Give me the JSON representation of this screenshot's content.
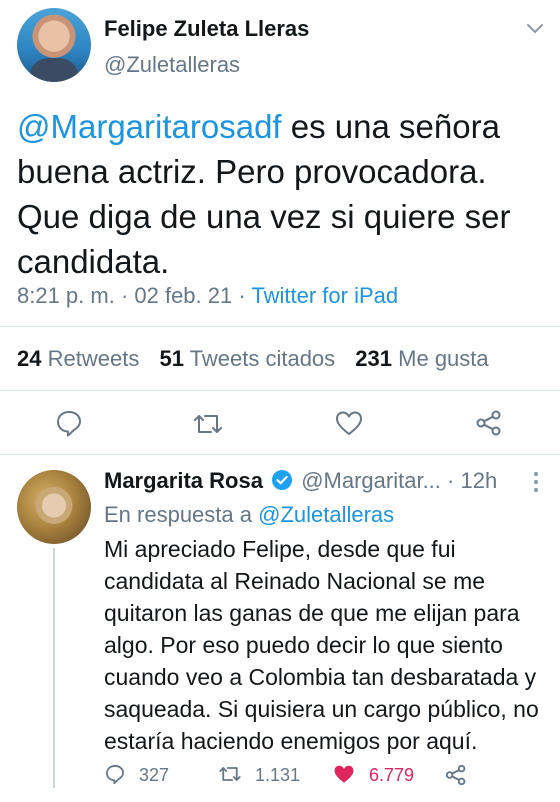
{
  "main_tweet": {
    "author_name": "Felipe Zuleta Lleras",
    "author_handle": "@Zuletalleras",
    "text_mention": "@Margaritarosadf",
    "text_rest": " es una señora buena actriz. Pero provocadora. Que diga de una vez si quiere ser candidata.",
    "time": "8:21 p. m. · 02 feb. 21 · ",
    "source": "Twitter for iPad",
    "retweets_count": "24",
    "retweets_label": "Retweets",
    "quotes_count": "51",
    "quotes_label": "Tweets citados",
    "likes_count": "231",
    "likes_label": "Me gusta"
  },
  "reply": {
    "author_name": "Margarita Rosa",
    "author_handle": "@Margaritar...",
    "time": "· 12h",
    "in_reply_prefix": "En respuesta a ",
    "in_reply_handle": "@Zuletalleras",
    "text": "Mi apreciado Felipe, desde que fui candidata al Reinado Nacional se me quitaron las ganas de que me elijan para algo. Por eso puedo decir lo que siento cuando veo a Colombia tan desbaratada y saqueada. Si quisiera un cargo público, no estaría haciendo enemigos por aquí.",
    "reply_count": "327",
    "retweet_count": "1.131",
    "like_count": "6.779"
  },
  "colors": {
    "link": "#1b95e0",
    "muted": "#657786",
    "like": "#e0245e",
    "verified": "#1da1f2"
  },
  "icons": [
    "chevron-down-icon",
    "reply-icon",
    "retweet-icon",
    "like-icon",
    "share-icon",
    "verified-icon",
    "more-icon"
  ]
}
